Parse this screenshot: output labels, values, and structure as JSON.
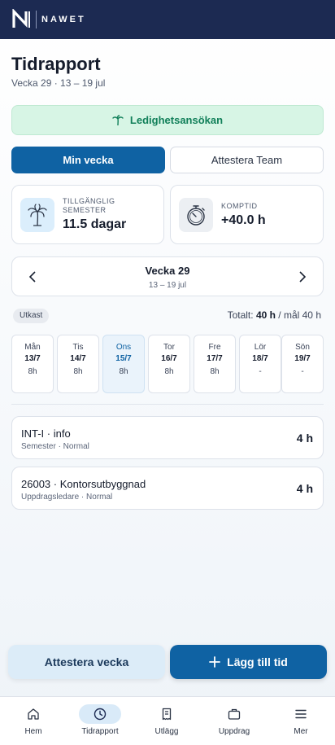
{
  "app": {
    "brand": "NAWET"
  },
  "header": {
    "title": "Tidrapport",
    "subtitle": "Vecka 29 · 13 – 19 jul"
  },
  "leave_button": {
    "label": "Ledighetsansökan",
    "icon": "palm-tree-icon",
    "color": "#12805a"
  },
  "tabs": [
    {
      "label": "Min vecka",
      "active": true
    },
    {
      "label": "Attestera Team",
      "active": false
    }
  ],
  "cards": {
    "vacation": {
      "label_line1": "TILLGÄNGLIG",
      "label_line2": "SEMESTER",
      "value": "11.5 dagar",
      "icon": "palm-tree-icon"
    },
    "comp_time": {
      "label": "KOMPTID",
      "value": "+40.0 h",
      "icon": "stopwatch-icon"
    }
  },
  "week_nav": {
    "title": "Vecka 29",
    "range": "13 – 19 jul"
  },
  "status": {
    "badge": "Utkast",
    "total_prefix": "Totalt:",
    "total_value": "40 h",
    "total_suffix": "/ mål 40 h"
  },
  "days": [
    {
      "name": "Mån",
      "date": "13/7",
      "hours": "8h"
    },
    {
      "name": "Tis",
      "date": "14/7",
      "hours": "8h"
    },
    {
      "name": "Ons",
      "date": "15/7",
      "hours": "8h",
      "active": true
    },
    {
      "name": "Tor",
      "date": "16/7",
      "hours": "8h"
    },
    {
      "name": "Fre",
      "date": "17/7",
      "hours": "8h"
    },
    {
      "name": "Lör",
      "date": "18/7",
      "hours": "-"
    },
    {
      "name": "Sön",
      "date": "19/7",
      "hours": "-"
    }
  ],
  "entries": [
    {
      "title": "INT-I · info",
      "sub": "Semester · Normal",
      "hours": "4 h"
    },
    {
      "title": "26003 · Kontorsutbyggnad",
      "sub": "Uppdragsledare · Normal",
      "hours": "4 h"
    }
  ],
  "actions": {
    "attest": "Attestera vecka",
    "add": "Lägg till tid"
  },
  "bottom_nav": [
    {
      "label": "Hem",
      "icon": "home-icon"
    },
    {
      "label": "Tidrapport",
      "icon": "clock-icon",
      "active": true
    },
    {
      "label": "Utlägg",
      "icon": "receipt-icon"
    },
    {
      "label": "Uppdrag",
      "icon": "briefcase-icon"
    },
    {
      "label": "Mer",
      "icon": "menu-icon"
    }
  ],
  "colors": {
    "primary": "#0f62a3",
    "navy": "#1c2a52",
    "success_bg": "#d7f5e5"
  }
}
